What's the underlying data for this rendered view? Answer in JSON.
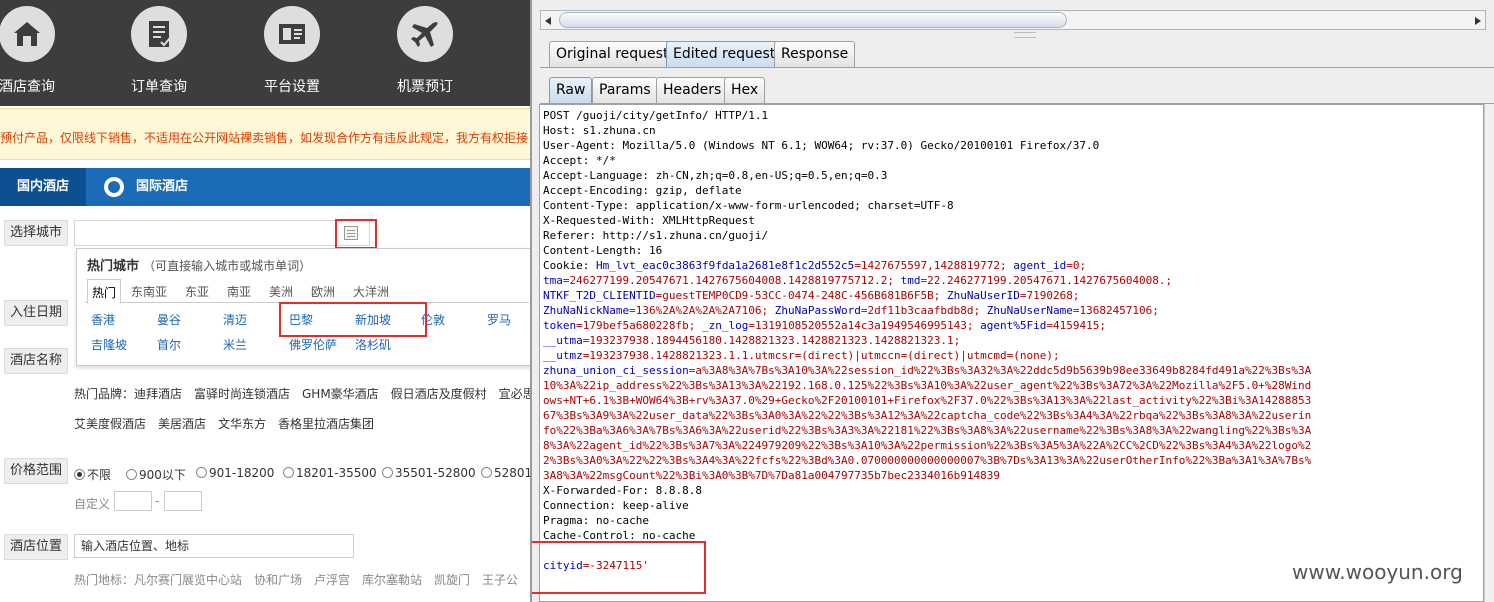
{
  "left_page": {
    "nav": [
      {
        "label": "酒店查询",
        "icon": "house-icon"
      },
      {
        "label": "订单查询",
        "icon": "document-icon"
      },
      {
        "label": "平台设置",
        "icon": "id-card-icon"
      },
      {
        "label": "机票预订",
        "icon": "airplane-icon"
      }
    ],
    "notice": "预付产品，仅限线下销售，不适用在公开网站裸卖销售，如发现合作方有违反此规定，我方有权拒接",
    "tabs": {
      "domestic": "国内酒店",
      "international": "国际酒店"
    },
    "form": {
      "city_label": "选择城市",
      "checkin_label": "入住日期",
      "hotel_name_label": "酒店名称",
      "price_label": "价格范围",
      "location_label": "酒店位置"
    },
    "city_popup": {
      "title": "热门城市",
      "hint": "（可直接输入城市或城市单词）",
      "tabs": [
        "热门",
        "东南亚",
        "东亚",
        "南亚",
        "美洲",
        "欧洲",
        "大洋洲"
      ],
      "row1": [
        "香港",
        "曼谷",
        "清迈",
        "巴黎",
        "新加坡",
        "伦敦",
        "罗马"
      ],
      "row2": [
        "吉隆坡",
        "首尔",
        "米兰",
        "佛罗伦萨",
        "洛杉矶"
      ]
    },
    "brands_line1": "热门品牌：迪拜酒店　富驿时尚连锁酒店　GHM豪华酒店　假日酒店及度假村　宜必思",
    "brands_line2": "艾美度假酒店　美居酒店　文华东方　香格里拉酒店集团",
    "price_options": [
      "不限",
      "900以下",
      "901-18200",
      "18201-35500",
      "35501-52800",
      "52801"
    ],
    "custom_label": "自定义",
    "custom_dash": "-",
    "location_input": "输入酒店位置、地标",
    "landmarks": "热门地标：凡尔赛门展览中心站　协和广场　卢浮宫　库尔塞勒站　凯旋门　王子公"
  },
  "burp": {
    "top_tabs": [
      "Original request",
      "Edited request",
      "Response"
    ],
    "sub_tabs": [
      "Raw",
      "Params",
      "Headers",
      "Hex"
    ],
    "request_lines": [
      [
        "POST /guoji/city/getInfo/ HTTP/1.1",
        ""
      ],
      [
        "Host: s1.zhuna.cn",
        ""
      ],
      [
        "User-Agent: Mozilla/5.0 (Windows NT 6.1; WOW64; rv:37.0) Gecko/20100101 Firefox/37.0",
        ""
      ],
      [
        "Accept: */*",
        ""
      ],
      [
        "Accept-Language: zh-CN,zh;q=0.8,en-US;q=0.5,en;q=0.3",
        ""
      ],
      [
        "Accept-Encoding: gzip, deflate",
        ""
      ],
      [
        "Content-Type: application/x-www-form-urlencoded; charset=UTF-8",
        ""
      ],
      [
        "X-Requested-With: XMLHttpRequest",
        ""
      ],
      [
        "Referer: http://s1.zhuna.cn/guoji/",
        ""
      ],
      [
        "Content-Length: 16",
        ""
      ],
      [
        "Cookie: ",
        "Hm_lvt_eac0c3863f9fda1a2681e8f1c2d552c5",
        "=1427675597,1428819772; ",
        "agent_id",
        "=0;"
      ],
      [
        "",
        "tma",
        "=246277199.20547671.1427675604008.1428819775712.2; ",
        "tmd",
        "=22.246277199.20547671.1427675604008.;"
      ],
      [
        "",
        "NTKF_T2D_CLIENTID",
        "=guestTEMP0CD9-53CC-0474-248C-456B681B6F5B; ",
        "ZhuNaUserID",
        "=7190268;"
      ],
      [
        "",
        "ZhuNaNickName",
        "=136%2A%2A%2A%2A7106; ",
        "ZhuNaPassWord",
        "=2df11b3caafbdb8d; ",
        "ZhuNaUserName",
        "=13682457106;"
      ],
      [
        "",
        "token",
        "=179bef5a680228fb; ",
        "_zn_log",
        "=1319108520552a14c3a1949546995143; ",
        "agent%5Fid",
        "=4159415;"
      ],
      [
        "",
        "__utma",
        "=193237938.1894456180.1428821323.1428821323.1428821323.1;"
      ],
      [
        "",
        "__utmz",
        "=193237938.1428821323.1.1.utmcsr=(direct)|utmccn=(direct)|utmcmd=(none);"
      ],
      [
        "",
        "zhuna_union_ci_session",
        "=a%3A8%3A%7Bs%3A10%3A%22session_id%22%3Bs%3A32%3A%22ddc5d9b5639b98ee33649b8284fd491a%22%3Bs%3A"
      ],
      [
        "",
        "",
        "10%3A%22ip_address%22%3Bs%3A13%3A%22192.168.0.125%22%3Bs%3A10%3A%22user_agent%22%3Bs%3A72%3A%22Mozilla%2F5.0+%28Wind"
      ],
      [
        "",
        "",
        "ows+NT+6.1%3B+WOW64%3B+rv%3A37.0%29+Gecko%2F20100101+Firefox%2F37.0%22%3Bs%3A13%3A%22last_activity%22%3Bi%3A14288853"
      ],
      [
        "",
        "",
        "67%3Bs%3A9%3A%22user_data%22%3Bs%3A0%3A%22%22%3Bs%3A12%3A%22captcha_code%22%3Bs%3A4%3A%22rbqa%22%3Bs%3A8%3A%22userin"
      ],
      [
        "",
        "",
        "fo%22%3Ba%3A6%3A%7Bs%3A6%3A%22userid%22%3Bs%3A3%3A%22181%22%3Bs%3A8%3A%22username%22%3Bs%3A8%3A%22wangling%22%3Bs%3A"
      ],
      [
        "",
        "",
        "8%3A%22agent_id%22%3Bs%3A7%3A%224979209%22%3Bs%3A10%3A%22permission%22%3Bs%3A5%3A%22A%2CC%2CD%22%3Bs%3A4%3A%22logo%2"
      ],
      [
        "",
        "",
        "2%3Bs%3A0%3A%22%22%3Bs%3A4%3A%22fcfs%22%3Bd%3A0.070000000000000007%3B%7Ds%3A13%3A%22userOtherInfo%22%3Ba%3A1%3A%7Bs%"
      ],
      [
        "",
        "",
        "3A8%3A%22msgCount%22%3Bi%3A0%3B%7D%7Da81a004797735b7bec2334016b914839"
      ],
      [
        "X-Forwarded-For: 8.8.8.8",
        ""
      ],
      [
        "Connection: keep-alive",
        ""
      ],
      [
        "Pragma: no-cache",
        ""
      ],
      [
        "Cache-Control: no-cache",
        ""
      ],
      [
        "",
        ""
      ],
      [
        "",
        "cityid",
        "=-3247115'"
      ]
    ]
  },
  "watermark": "www.wooyun.org",
  "colors": {
    "nav_bg": "#3d3d3d",
    "tab_blue": "#1b6bb8",
    "highlight_red": "#e0302e",
    "param_key": "#0000c0",
    "param_value": "#b00000"
  }
}
